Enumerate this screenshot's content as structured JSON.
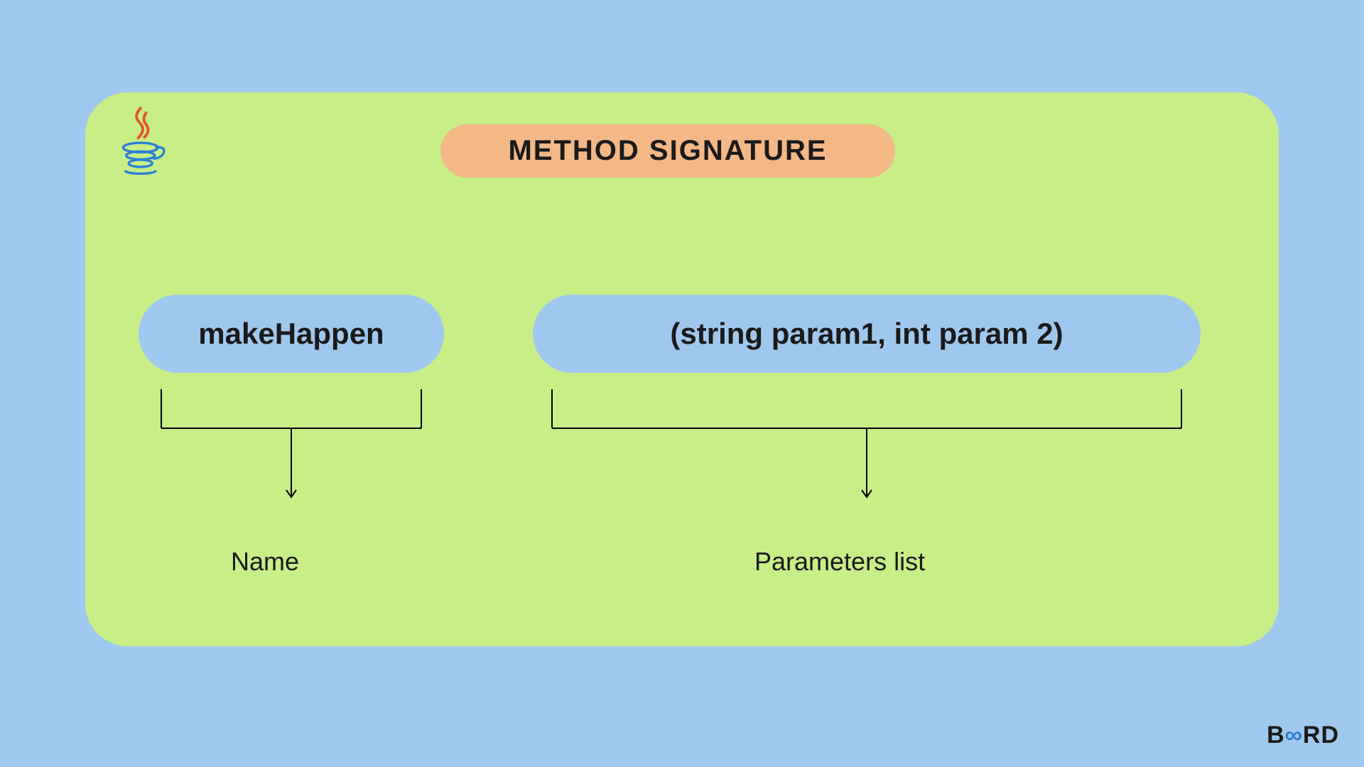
{
  "title": "METHOD SIGNATURE",
  "components": {
    "name": {
      "text": "makeHappen",
      "label": "Name"
    },
    "params": {
      "text": "(string param1, int param 2)",
      "label": "Parameters list"
    }
  },
  "brand": {
    "prefix": "B",
    "accent": "∞",
    "suffix": "RD"
  },
  "colors": {
    "background": "#9FC8EE",
    "card": "#C7EE87",
    "titlePill": "#F4B786",
    "pill": "#9FC8EE",
    "text": "#1a1a1a",
    "brandAccent": "#2B7FD6"
  }
}
